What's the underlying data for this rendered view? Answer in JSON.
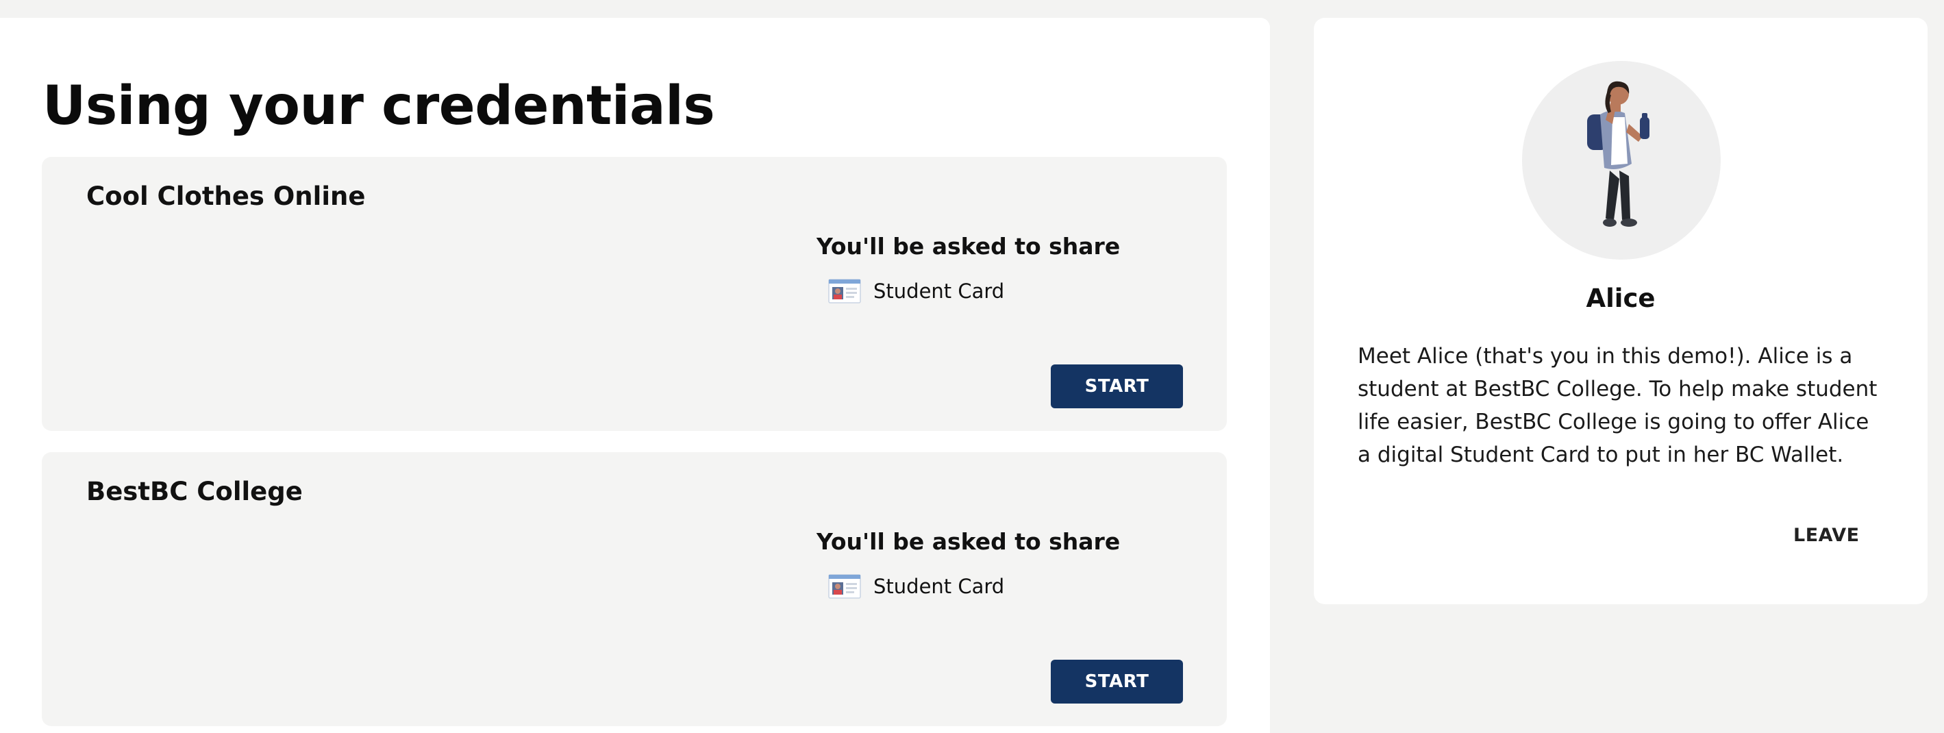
{
  "page": {
    "title": "Using your credentials"
  },
  "use_cases": [
    {
      "title": "Cool Clothes Online",
      "share_heading": "You'll be asked to share",
      "credentials": [
        {
          "label": "Student Card",
          "icon": "student-card-icon"
        }
      ],
      "start_label": "START"
    },
    {
      "title": "BestBC College",
      "share_heading": "You'll be asked to share",
      "credentials": [
        {
          "label": "Student Card",
          "icon": "student-card-icon"
        }
      ],
      "start_label": "START"
    }
  ],
  "character": {
    "name": "Alice",
    "description": "Meet Alice (that's you in this demo!). Alice is a student at BestBC College. To help make student life easier, BestBC College is going to offer Alice a digital Student Card to put in her BC Wallet.",
    "leave_label": "LEAVE",
    "avatar_icon": "student-avatar-illustration"
  },
  "colors": {
    "background": "#f3f3f2",
    "card_background": "#f4f4f3",
    "primary_button": "#143463",
    "panel": "#ffffff"
  }
}
